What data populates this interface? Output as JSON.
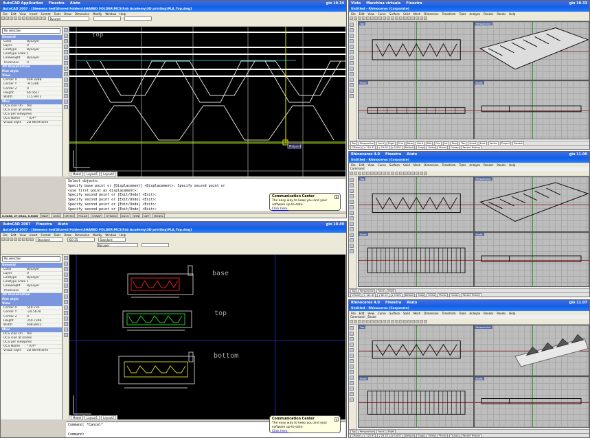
{
  "top_left": {
    "taskbar": {
      "app": "AutoCAD Application",
      "menu1": "Finestra",
      "menu2": "Aiuto",
      "clock": "gio 10.34"
    },
    "title": "AutoCAD 2007 - [Siemens hed\\Shared Folders\\SHARED FOLDER\\MCS\\Fab Academy\\3D printing\\PLA_Top.dwg]",
    "menu_items": [
      "File",
      "Edit",
      "View",
      "Insert",
      "Format",
      "Tools",
      "Draw",
      "Dimension",
      "Modify",
      "Window",
      "Help"
    ],
    "layer_select": "ByLayer",
    "props": {
      "selection": "No selection",
      "sections": [
        {
          "header": "General",
          "rows": [
            [
              "Color",
              "ByLayer"
            ],
            [
              "Layer",
              "0"
            ],
            [
              "Linetype",
              "ByLayer"
            ],
            [
              "Linetype scale",
              "1"
            ],
            [
              "Lineweight",
              "ByLayer"
            ],
            [
              "Thickness",
              "0"
            ]
          ]
        },
        {
          "header": "3D Visualization",
          "rows": []
        },
        {
          "header": "Plot style",
          "rows": []
        },
        {
          "header": "View",
          "rows": [
            [
              "Center X",
              "469.3388"
            ],
            [
              "Center Y",
              "-9.5306"
            ],
            [
              "Center Z",
              "0"
            ],
            [
              "Height",
              "66.5617"
            ],
            [
              "Width",
              "115.9972"
            ]
          ]
        },
        {
          "header": "Misc",
          "rows": [
            [
              "UCS icon On",
              "Yes"
            ],
            [
              "UCS icon at origin",
              "Yes"
            ],
            [
              "UCS per viewport",
              "Yes"
            ],
            [
              "UCS Name",
              "*TOP*"
            ],
            [
              "Visual Style",
              "2D Wireframe"
            ]
          ]
        }
      ]
    },
    "canvas_label": "top",
    "snap_tooltip": "Midpoint",
    "layout_tabs": [
      "Model",
      "Layout1",
      "Layout2"
    ],
    "command_lines": [
      "Select objects:",
      "Specify base point or [Displacement] <Displacement>: Specify second point or",
      "<use first point as displacement>:",
      "Specify second point or [Exit/Undo] <Exit>:",
      "Specify second point or [Exit/Undo] <Exit>:",
      "Specify second point or [Exit/Undo] <Exit>:",
      "Specify second point or [Exit/Undo] <Exit>:"
    ],
    "status_coords": "6.0286, 27.0944, 0.0000",
    "status_buttons": [
      "SNAP",
      "GRID",
      "ORTHO",
      "POLAR",
      "OSNAP",
      "OTRACK",
      "DUCS",
      "DYN",
      "LWT",
      "MODEL"
    ],
    "bubble": {
      "title": "Communication Center",
      "text": "The easy way to keep you and your software up-to-date.",
      "link": "Click here."
    }
  },
  "bottom_left": {
    "taskbar": {
      "app": "AutoCAD 2007",
      "menu1": "Finestra",
      "menu2": "Aiuto",
      "clock": "gio 10.49"
    },
    "title": "AutoCAD 2007 - [Siemens hed\\Shared Folders\\SHARED FOLDER\\MCS\\Fab Academy\\3D printing\\PLA_Top.dwg]",
    "menu_items": [
      "File",
      "Edit",
      "View",
      "Insert",
      "Format",
      "Tools",
      "Draw",
      "Dimension",
      "Modify",
      "Window",
      "Help"
    ],
    "styles": [
      "Standard",
      "ISO-25",
      "Standard"
    ],
    "layer_select": "ByLayer",
    "props": {
      "selection": "No selection",
      "sections": [
        {
          "header": "General",
          "rows": [
            [
              "Color",
              "ByLayer"
            ],
            [
              "Layer",
              "0"
            ],
            [
              "Linetype",
              "ByLayer"
            ],
            [
              "Linetype scale",
              "1"
            ],
            [
              "Lineweight",
              "ByLayer"
            ],
            [
              "Thickness",
              "0"
            ]
          ]
        },
        {
          "header": "3D Visualization",
          "rows": []
        },
        {
          "header": "Plot style",
          "rows": []
        },
        {
          "header": "View",
          "rows": [
            [
              "Center X",
              "540.735"
            ],
            [
              "Center Y",
              "-24.5678"
            ],
            [
              "Center Z",
              "0"
            ],
            [
              "Height",
              "350.7396"
            ],
            [
              "Width",
              "608.8922"
            ]
          ]
        },
        {
          "header": "Misc",
          "rows": [
            [
              "UCS icon On",
              "Yes"
            ],
            [
              "UCS icon at origin",
              "Yes"
            ],
            [
              "UCS per viewport",
              "Yes"
            ],
            [
              "UCS Name",
              "*TOP*"
            ],
            [
              "Visual Style",
              "2D Wireframe"
            ]
          ]
        }
      ]
    },
    "labels": [
      "base",
      "top",
      "bottom"
    ],
    "layout_tabs": [
      "Model",
      "Layout1",
      "Layout2"
    ],
    "command_lines": [
      "Command: *Cancel*",
      "",
      "Command:"
    ],
    "bubble": {
      "title": "Communication Center",
      "text": "The easy way to keep you and your software up-to-date.",
      "link": "Click here."
    }
  },
  "rhino": [
    {
      "taskbar": {
        "menu1": "Vista",
        "menu2": "Macchina virtuale",
        "menu3": "Finestra",
        "clock": "gio 10.33"
      },
      "title": "Untitled - Rhinoceros (Corporate)",
      "menu_items": [
        "File",
        "Edit",
        "View",
        "Curve",
        "Surface",
        "Solid",
        "Mesh",
        "Dimension",
        "Transform",
        "Tools",
        "Analyze",
        "Render",
        "Panels",
        "Help"
      ],
      "viewports": [
        "Top",
        "Perspective",
        "Front",
        "Right"
      ],
      "tabs": [
        "Top",
        "Perspective",
        "Front",
        "Right"
      ],
      "osnaps": [
        "End",
        "Near",
        "Point",
        "Mid",
        "Cen",
        "Int",
        "Perp",
        "Tan",
        "Quad",
        "Knot",
        "Vertex",
        "Project",
        "Disable"
      ],
      "status": [
        "CPlane",
        "x 114.31",
        "y 24.00",
        "z 0.000",
        "Default",
        "Snap",
        "Ortho",
        "Planar",
        "Osnap",
        "Record History"
      ]
    },
    {
      "taskbar": {
        "app": "Rhinoceros 4.0",
        "menu1": "Finestra",
        "menu2": "Aiuto",
        "clock": "gio 11.00"
      },
      "title": "Untitled - Rhinoceros (Corporate)",
      "menu_items": [
        "File",
        "Edit",
        "View",
        "Curve",
        "Surface",
        "Solid",
        "Mesh",
        "Dimension",
        "Transform",
        "Tools",
        "Analyze",
        "Render",
        "Panels",
        "Help"
      ],
      "command": "Command:",
      "viewports": [
        "Top",
        "Perspective",
        "Front",
        "Right"
      ],
      "tabs": [
        "Top",
        "Perspective",
        "Front",
        "Right"
      ],
      "status": [
        "CPlane",
        "x 121.45",
        "y 62.15",
        "z 0.000",
        "Default",
        "Snap",
        "Ortho",
        "Planar",
        "Osnap",
        "Record History"
      ]
    },
    {
      "taskbar": {
        "app": "Rhinoceros 4.0",
        "menu1": "Finestra",
        "menu2": "Aiuto",
        "clock": "gio 11.07"
      },
      "title": "Untitled - Rhinoceros (Corporate)",
      "menu_items": [
        "File",
        "Edit",
        "View",
        "Curve",
        "Surface",
        "Solid",
        "Mesh",
        "Dimension",
        "Transform",
        "Tools",
        "Analyze",
        "Render",
        "Panels",
        "Help"
      ],
      "command": "Command: _Shade",
      "viewports": [
        "Top",
        "Perspective",
        "Front",
        "Right"
      ],
      "tabs": [
        "Top",
        "Perspective",
        "Front",
        "Right"
      ],
      "status": [
        "CPlane",
        "x 124.93",
        "y 26.18",
        "z 0.000",
        "Default",
        "Snap",
        "Ortho",
        "Planar",
        "Osnap",
        "Record History"
      ]
    }
  ]
}
